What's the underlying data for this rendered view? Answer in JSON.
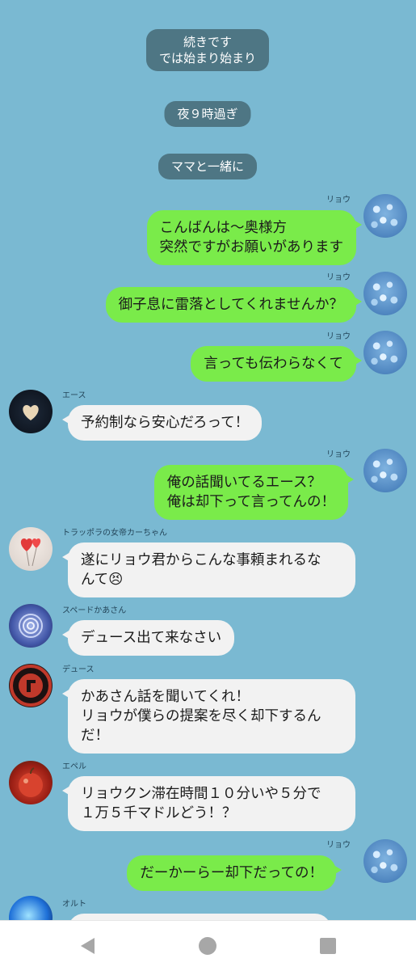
{
  "system_messages": [
    "続きです\nでは始まり始まり",
    "夜９時過ぎ",
    "ママと一緒に"
  ],
  "messages": [
    {
      "sender": "リョウ",
      "side": "right",
      "text": "こんばんは〜奥様方\n突然ですがお願いがあります"
    },
    {
      "sender": "リョウ",
      "side": "right",
      "text": "御子息に雷落としてくれませんか？"
    },
    {
      "sender": "リョウ",
      "side": "right",
      "text": "言っても伝わらなくて"
    },
    {
      "sender": "エース",
      "side": "left",
      "text": "予約制なら安心だろって！"
    },
    {
      "sender": "リョウ",
      "side": "right",
      "text": "俺の話聞いてるエース？\n俺は却下って言ってんの！"
    },
    {
      "sender": "トラッポラの女帝カーちゃん",
      "side": "left",
      "text": "遂にリョウ君からこんな事頼まれるな\nんて😣"
    },
    {
      "sender": "スペードかあさん",
      "side": "left",
      "text": "デュース出て来なさい"
    },
    {
      "sender": "デュース",
      "side": "left",
      "text": "かあさん話を聞いてくれ！\nリョウが僕らの提案を尽く却下するん\nだ！"
    },
    {
      "sender": "エペル",
      "side": "left",
      "text": "リョウクン滞在時間１０分いや５分で\n１万５千マドルどう！？"
    },
    {
      "sender": "リョウ",
      "side": "right",
      "text": "だーかーらー却下だっての！"
    },
    {
      "sender": "オルト",
      "side": "left",
      "text": ""
    }
  ],
  "colors": {
    "background": "#7ab9d2",
    "outgoing": "#7aeb4a",
    "incoming": "#f2f2f2",
    "system": "#4e7684"
  },
  "navbar": {
    "back": "back-icon",
    "home": "home-icon",
    "recents": "recents-icon"
  }
}
